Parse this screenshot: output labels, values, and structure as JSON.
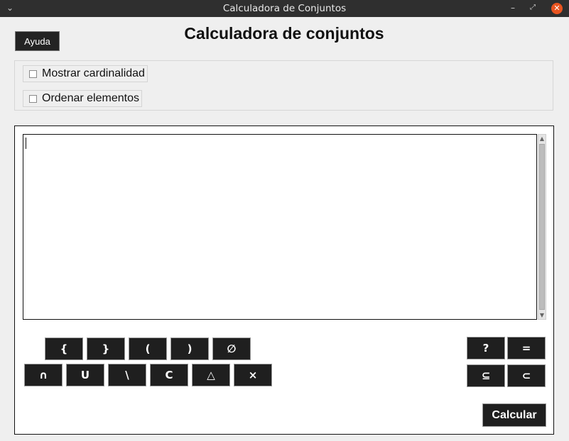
{
  "window": {
    "title": "Calculadora de Conjuntos",
    "menu_glyph": "⌄",
    "minimize_glyph": "–",
    "maximize_glyph": "⤢",
    "close_glyph": "✕"
  },
  "header": {
    "help_label": "Ayuda",
    "title": "Calculadora de conjuntos"
  },
  "options": {
    "show_cardinality_label": "Mostrar cardinalidad",
    "show_cardinality_checked": false,
    "sort_elements_label": "Ordenar elementos",
    "sort_elements_checked": false
  },
  "editor": {
    "value": ""
  },
  "keypad": {
    "row1": [
      "{",
      "}",
      "(",
      ")",
      "∅"
    ],
    "row2": [
      "∩",
      "U",
      "\\",
      "C",
      "△",
      "×"
    ],
    "right_row1": [
      "?",
      "="
    ],
    "right_row2": [
      "⊆",
      "⊂"
    ],
    "calculate_label": "Calcular"
  },
  "colors": {
    "title_bar": "#2f2f2f",
    "close_button": "#e95420",
    "button_bg": "#1f1f1f",
    "window_bg": "#efefef"
  }
}
